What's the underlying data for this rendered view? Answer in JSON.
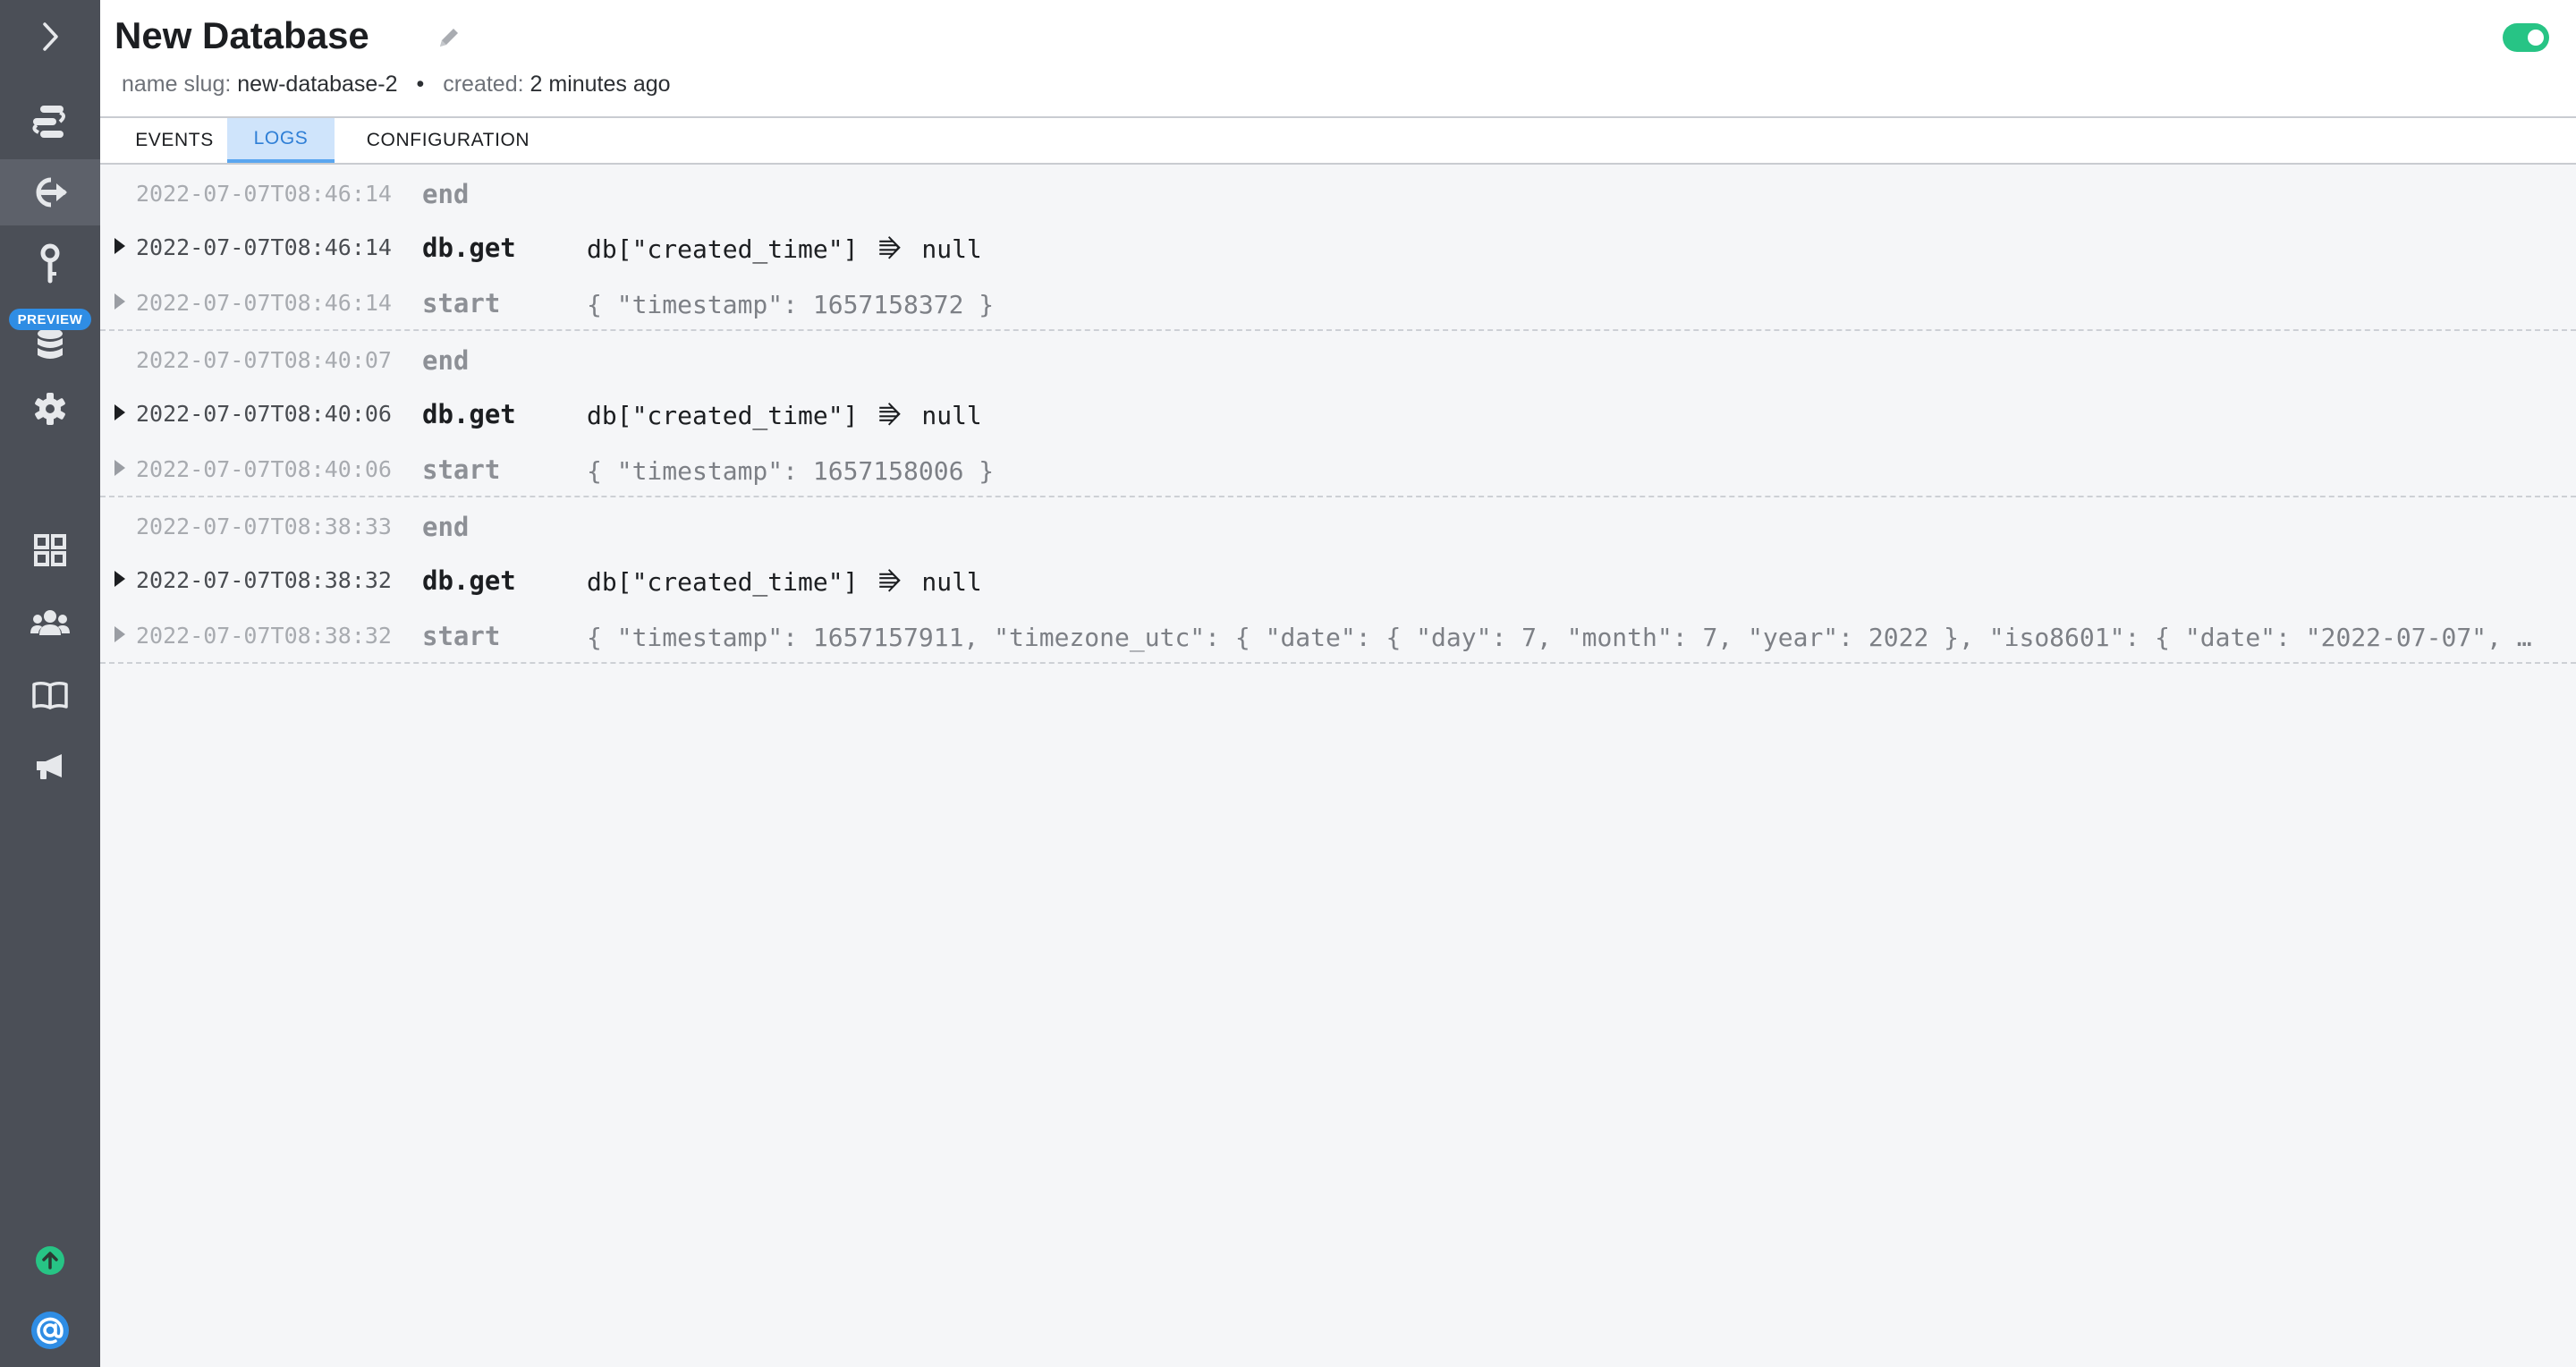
{
  "header": {
    "title": "New Database",
    "slug_label": "name slug:",
    "slug_value": "new-database-2",
    "separator": "•",
    "created_label": "created:",
    "created_value": "2 minutes ago",
    "toggle_on": true
  },
  "tabs": [
    {
      "label": "EVENTS",
      "active": false
    },
    {
      "label": "LOGS",
      "active": true
    },
    {
      "label": "CONFIGURATION",
      "active": false
    }
  ],
  "sidebar": {
    "items": [
      {
        "icon": "chevron-right-icon"
      },
      {
        "icon": "flows-icon"
      },
      {
        "icon": "endpoint-arrow-icon",
        "active": true
      },
      {
        "icon": "key-icon"
      },
      {
        "icon": "database-icon",
        "badge": "PREVIEW"
      },
      {
        "icon": "gear-icon"
      },
      {
        "icon": "grid-icon"
      },
      {
        "icon": "team-icon"
      },
      {
        "icon": "book-icon"
      },
      {
        "icon": "megaphone-icon"
      },
      {
        "icon": "upload-status-icon"
      },
      {
        "icon": "at-sign-icon"
      }
    ],
    "preview_badge": "PREVIEW"
  },
  "logs": [
    {
      "end": {
        "ts": "2022-07-07T08:46:14",
        "event": "end"
      },
      "get": {
        "ts": "2022-07-07T08:46:14",
        "event": "db.get",
        "key": "db[\"created_time\"]",
        "arrow": "⭆",
        "result": "null"
      },
      "start": {
        "ts": "2022-07-07T08:46:14",
        "event": "start",
        "payload": "{ \"timestamp\": 1657158372 }"
      }
    },
    {
      "end": {
        "ts": "2022-07-07T08:40:07",
        "event": "end"
      },
      "get": {
        "ts": "2022-07-07T08:40:06",
        "event": "db.get",
        "key": "db[\"created_time\"]",
        "arrow": "⭆",
        "result": "null"
      },
      "start": {
        "ts": "2022-07-07T08:40:06",
        "event": "start",
        "payload": "{ \"timestamp\": 1657158006 }"
      }
    },
    {
      "end": {
        "ts": "2022-07-07T08:38:33",
        "event": "end"
      },
      "get": {
        "ts": "2022-07-07T08:38:32",
        "event": "db.get",
        "key": "db[\"created_time\"]",
        "arrow": "⭆",
        "result": "null"
      },
      "start": {
        "ts": "2022-07-07T08:38:32",
        "event": "start",
        "payload": "{ \"timestamp\": 1657157911, \"timezone_utc\": { \"date\": { \"day\": 7, \"month\": 7, \"year\": 2022 }, \"iso8601\": { \"date\": \"2022-07-07\", …"
      }
    }
  ],
  "colors": {
    "sidebar": "#4b4f57",
    "accent": "#2f7fd6",
    "toggle": "#27c485",
    "preview_badge": "#2f8de4"
  }
}
